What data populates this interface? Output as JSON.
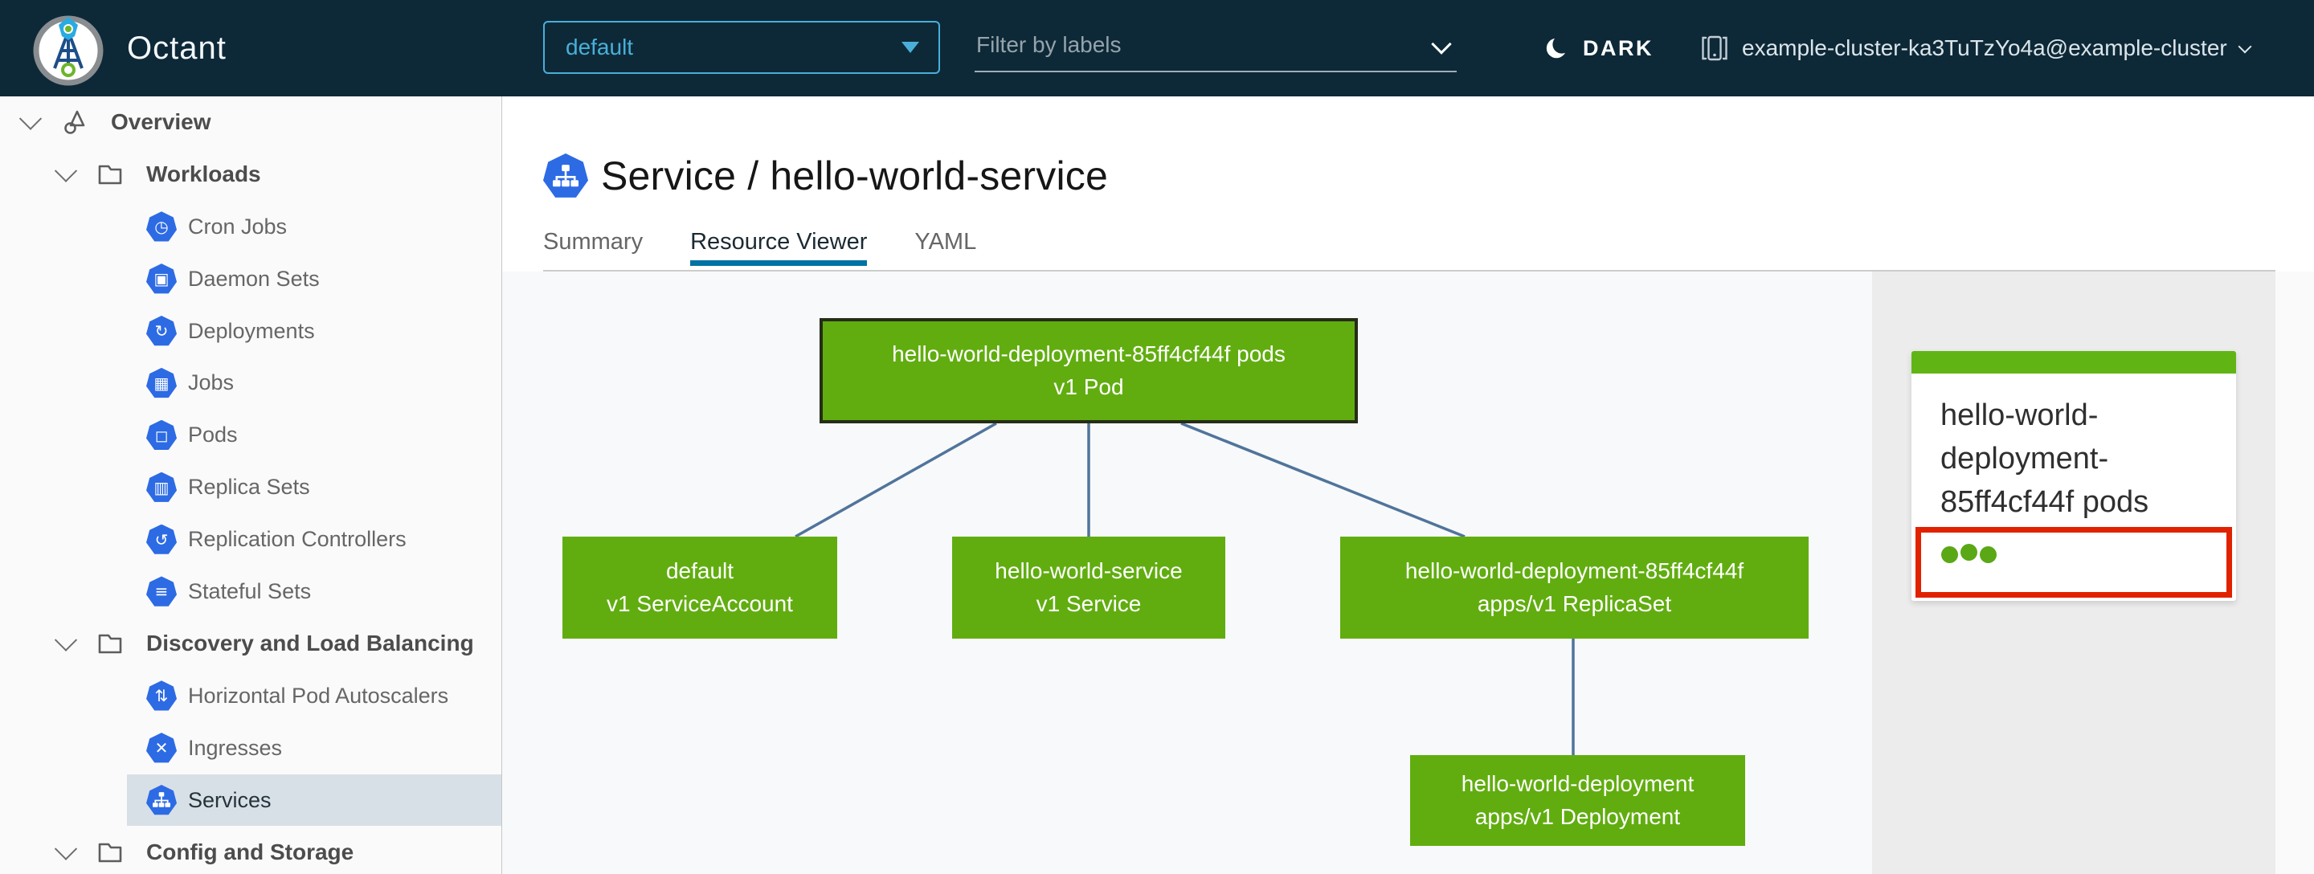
{
  "header": {
    "app_title": "Octant",
    "namespace": {
      "value": "default"
    },
    "filter": {
      "placeholder": "Filter by labels"
    },
    "theme_toggle": {
      "label": "DARK",
      "icon": "moon-icon"
    },
    "cluster": {
      "label": "example-cluster-ka3TuTzYo4a@example-cluster",
      "icon": "cluster-icon"
    }
  },
  "sidebar": {
    "items": [
      {
        "label": "Overview",
        "level": 1,
        "icon": "overview-icon",
        "expanded": true
      },
      {
        "label": "Workloads",
        "level": 2,
        "icon": "folder-icon",
        "expanded": true
      },
      {
        "label": "Cron Jobs",
        "level": 3,
        "icon": "cron-jobs-icon",
        "glyph": "◷"
      },
      {
        "label": "Daemon Sets",
        "level": 3,
        "icon": "daemon-sets-icon",
        "glyph": "▣"
      },
      {
        "label": "Deployments",
        "level": 3,
        "icon": "deployments-icon",
        "glyph": "↻"
      },
      {
        "label": "Jobs",
        "level": 3,
        "icon": "jobs-icon",
        "glyph": "▦"
      },
      {
        "label": "Pods",
        "level": 3,
        "icon": "pods-icon",
        "glyph": "◻"
      },
      {
        "label": "Replica Sets",
        "level": 3,
        "icon": "replica-sets-icon",
        "glyph": "▥"
      },
      {
        "label": "Replication Controllers",
        "level": 3,
        "icon": "replication-controllers-icon",
        "glyph": "↺"
      },
      {
        "label": "Stateful Sets",
        "level": 3,
        "icon": "stateful-sets-icon",
        "glyph": "≡"
      },
      {
        "label": "Discovery and Load Balancing",
        "level": 2,
        "icon": "folder-icon",
        "expanded": true
      },
      {
        "label": "Horizontal Pod Autoscalers",
        "level": 3,
        "icon": "horizontal-pod-autoscalers-icon",
        "glyph": "⇅"
      },
      {
        "label": "Ingresses",
        "level": 3,
        "icon": "ingresses-icon",
        "glyph": "✕"
      },
      {
        "label": "Services",
        "level": 3,
        "icon": "services-icon",
        "selected": true
      },
      {
        "label": "Config and Storage",
        "level": 2,
        "icon": "folder-icon",
        "expanded": true
      }
    ]
  },
  "content": {
    "title": "Service / hello-world-service",
    "kind_icon": "service-icon",
    "tabs": [
      {
        "label": "Summary",
        "active": false
      },
      {
        "label": "Resource Viewer",
        "active": true
      },
      {
        "label": "YAML",
        "active": false
      }
    ]
  },
  "graph": {
    "nodes": [
      {
        "id": "pod",
        "name": "hello-world-deployment-85ff4cf44f pods",
        "kind": "v1 Pod",
        "selected": true
      },
      {
        "id": "serviceaccount",
        "name": "default",
        "kind": "v1 ServiceAccount"
      },
      {
        "id": "service",
        "name": "hello-world-service",
        "kind": "v1 Service"
      },
      {
        "id": "replicaset",
        "name": "hello-world-deployment-85ff4cf44f",
        "kind": "apps/v1 ReplicaSet"
      },
      {
        "id": "deployment",
        "name": "hello-world-deployment",
        "kind": "apps/v1 Deployment"
      }
    ],
    "edges": [
      [
        "pod",
        "serviceaccount"
      ],
      [
        "pod",
        "service"
      ],
      [
        "pod",
        "replicaset"
      ],
      [
        "replicaset",
        "deployment"
      ]
    ]
  },
  "detail_panel": {
    "card": {
      "title": "hello-world-deployment-85ff4cf44f pods",
      "pod_status_ok_count": 3,
      "highlighted": true
    }
  },
  "colors": {
    "header_bg": "#0d2938",
    "accent_blue": "#49afd9",
    "tab_active_blue": "#0072a3",
    "node_green": "#61ad10",
    "card_bar_green": "#60b515",
    "status_dot_green": "#5aa816",
    "highlight_red": "#e12200",
    "edge_blue": "#50749c",
    "selected_row_bg": "#d8e0e7",
    "k8s_icon_blue": "#2d6be4"
  }
}
